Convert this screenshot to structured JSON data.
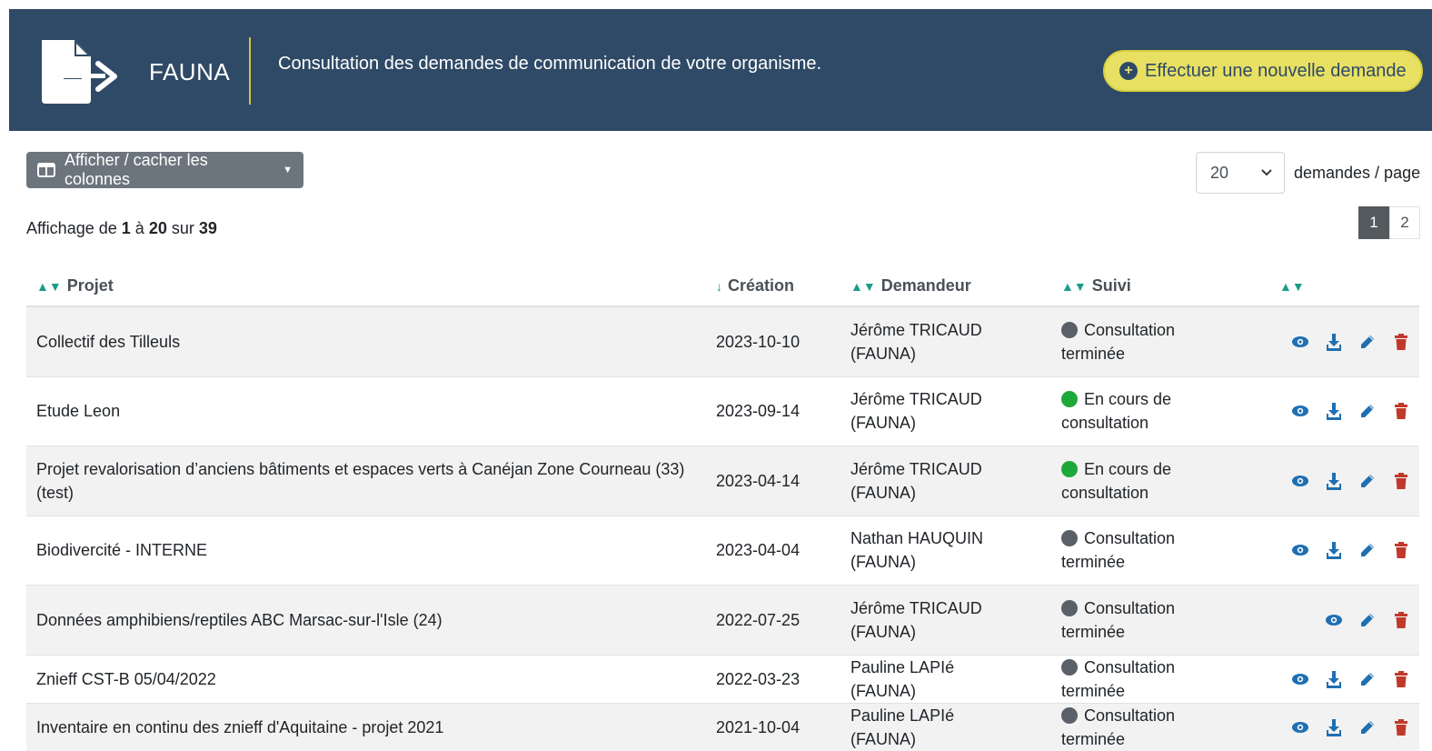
{
  "header": {
    "brand": "FAUNA",
    "subtitle": "Consultation des demandes de communication de votre organisme.",
    "new_request_label": "Effectuer une nouvelle demande",
    "background_color": "#2f4a66",
    "accent_color": "#e8e063"
  },
  "toolbar": {
    "columns_button_label": "Afficher / cacher les colonnes",
    "per_page_value": "20",
    "per_page_label": "demandes / page"
  },
  "info": {
    "prefix": "Affichage de",
    "from": "1",
    "to_word": "à",
    "to": "20",
    "of_word": "sur",
    "total": "39"
  },
  "pagination": {
    "pages": [
      "1",
      "2"
    ],
    "current": "1"
  },
  "table": {
    "columns": [
      "Projet",
      "Création",
      "Demandeur",
      "Suivi",
      ""
    ],
    "rows": [
      {
        "projet": "Collectif des Tilleuls",
        "creation": "2023-10-10",
        "demandeur": "Jérôme TRICAUD (FAUNA)",
        "suivi": "Consultation terminée",
        "status": "done",
        "download": true
      },
      {
        "projet": "Etude Leon",
        "creation": "2023-09-14",
        "demandeur": "Jérôme TRICAUD (FAUNA)",
        "suivi": "En cours de consultation",
        "status": "live",
        "download": true
      },
      {
        "projet": "Projet revalorisation d’anciens bâtiments et espaces verts à Canéjan Zone Courneau (33) (test)",
        "creation": "2023-04-14",
        "demandeur": "Jérôme TRICAUD (FAUNA)",
        "suivi": "En cours de consultation",
        "status": "live",
        "download": true
      },
      {
        "projet": "Biodivercité - INTERNE",
        "creation": "2023-04-04",
        "demandeur": "Nathan HAUQUIN (FAUNA)",
        "suivi": "Consultation terminée",
        "status": "done",
        "download": true
      },
      {
        "projet": "Données amphibiens/reptiles ABC Marsac-sur-l'Isle (24)",
        "creation": "2022-07-25",
        "demandeur": "Jérôme TRICAUD (FAUNA)",
        "suivi": "Consultation terminée",
        "status": "done",
        "download": false
      },
      {
        "projet": "Znieff CST-B 05/04/2022",
        "creation": "2022-03-23",
        "demandeur": "Pauline LAPIé (FAUNA)",
        "suivi": "Consultation terminée",
        "status": "done",
        "download": true
      },
      {
        "projet": "Inventaire en continu des znieff d'Aquitaine - projet 2021",
        "creation": "2021-10-04",
        "demandeur": "Pauline LAPIé (FAUNA)",
        "suivi": "Consultation terminée",
        "status": "done",
        "download": true
      }
    ]
  },
  "icons": {
    "view": "eye-icon",
    "download": "download-icon",
    "edit": "pencil-icon",
    "delete": "trash-icon"
  },
  "colors": {
    "icon_blue": "#1f6fb2",
    "icon_red": "#c0392b",
    "status_done": "#5a6068",
    "status_live": "#1fa83a",
    "sort_icon": "#1a9c8c"
  }
}
